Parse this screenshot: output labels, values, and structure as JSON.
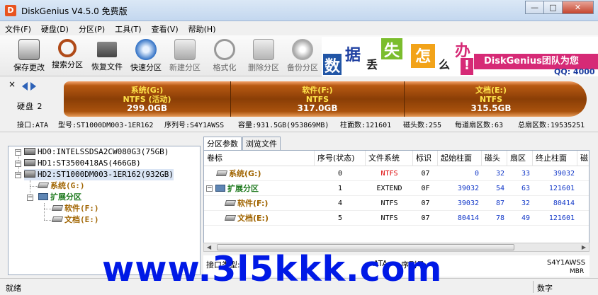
{
  "window": {
    "title": "DiskGenius V4.5.0 免费版",
    "minimize": "—",
    "maximize": "□",
    "close": "✕"
  },
  "menu": [
    "文件(F)",
    "硬盘(D)",
    "分区(P)",
    "工具(T)",
    "查看(V)",
    "帮助(H)"
  ],
  "toolbar": [
    {
      "label": "保存更改",
      "icon": "save-icon",
      "enabled": true
    },
    {
      "label": "搜索分区",
      "icon": "search-partition-icon",
      "enabled": true
    },
    {
      "label": "恢复文件",
      "icon": "recover-files-icon",
      "enabled": true
    },
    {
      "label": "快速分区",
      "icon": "quick-partition-icon",
      "enabled": true
    },
    {
      "label": "新建分区",
      "icon": "new-partition-icon",
      "enabled": false
    },
    {
      "label": "格式化",
      "icon": "format-icon",
      "enabled": false
    },
    {
      "label": "删除分区",
      "icon": "delete-partition-icon",
      "enabled": false
    },
    {
      "label": "备份分区",
      "icon": "backup-partition-icon",
      "enabled": false
    }
  ],
  "ad": {
    "chars": [
      "数",
      "据",
      "丢",
      "失",
      "怎",
      "么",
      "办",
      "!"
    ],
    "slogan": "DiskGenius团队为您",
    "qq": "QQ: 4000"
  },
  "disk_bar": {
    "close_glyph": "×",
    "disk_label": "硬盘 2",
    "segments": [
      {
        "name": "系统(G:)",
        "fs": "NTFS (活动)",
        "capacity": "299.0GB"
      },
      {
        "name": "软件(F:)",
        "fs": "NTFS",
        "capacity": "317.0GB"
      },
      {
        "name": "文档(E:)",
        "fs": "NTFS",
        "capacity": "315.5GB"
      }
    ]
  },
  "disk_info": {
    "interface": "接口:ATA",
    "model": "型号:ST1000DM003-1ER162",
    "serial": "序列号:S4Y1AWSS",
    "capacity": "容量:931.5GB(953869MB)",
    "cylinders": "柱面数:121601",
    "heads": "磁头数:255",
    "sectors_per_track": "每道扇区数:63",
    "total_sectors": "总扇区数:19535251"
  },
  "tree": {
    "disks": [
      {
        "label": "HD0:INTELSSDSA2CW080G3(75GB)"
      },
      {
        "label": "HD1:ST3500418AS(466GB)"
      },
      {
        "label": "HD2:ST1000DM003-1ER162(932GB)"
      }
    ],
    "partitions": {
      "system": "系统(G:)",
      "extended": "扩展分区",
      "software": "软件(F:)",
      "documents": "文档(E:)"
    },
    "expand_minus": "−",
    "expand_plus": "+"
  },
  "tabs": [
    "分区参数",
    "浏览文件"
  ],
  "grid": {
    "headers": [
      "卷标",
      "序号(状态)",
      "文件系统",
      "标识",
      "起始柱面",
      "磁头",
      "扇区",
      "终止柱面",
      "磁"
    ],
    "rows": [
      {
        "label": "系统(G:)",
        "index": "0",
        "fs": "NTFS",
        "id": "07",
        "start_cyl": "0",
        "head": "32",
        "sector": "33",
        "end_cyl": "39032"
      },
      {
        "label": "扩展分区",
        "index": "1",
        "fs": "EXTEND",
        "id": "0F",
        "start_cyl": "39032",
        "head": "54",
        "sector": "63",
        "end_cyl": "121601"
      },
      {
        "label": "软件(F:)",
        "index": "4",
        "fs": "NTFS",
        "id": "07",
        "start_cyl": "39032",
        "head": "87",
        "sector": "32",
        "end_cyl": "80414"
      },
      {
        "label": "文档(E:)",
        "index": "5",
        "fs": "NTFS",
        "id": "07",
        "start_cyl": "80414",
        "head": "78",
        "sector": "49",
        "end_cyl": "121601"
      }
    ]
  },
  "details": {
    "interface_label": "接口类型:",
    "interface_value": "ATA",
    "serial_label": "序列号:",
    "serial_value": "S4Y1AWSS",
    "mbr_value": "MBR"
  },
  "status": {
    "text": "就绪",
    "numlock": "数字"
  },
  "watermark": "www.3l5kkk.com",
  "colors": {
    "accent": "#0019e6",
    "bar": "#8a3e06",
    "segment_text": "#ffe44a",
    "partition_brown": "#a06400",
    "extended_green": "#1f7a1f"
  }
}
